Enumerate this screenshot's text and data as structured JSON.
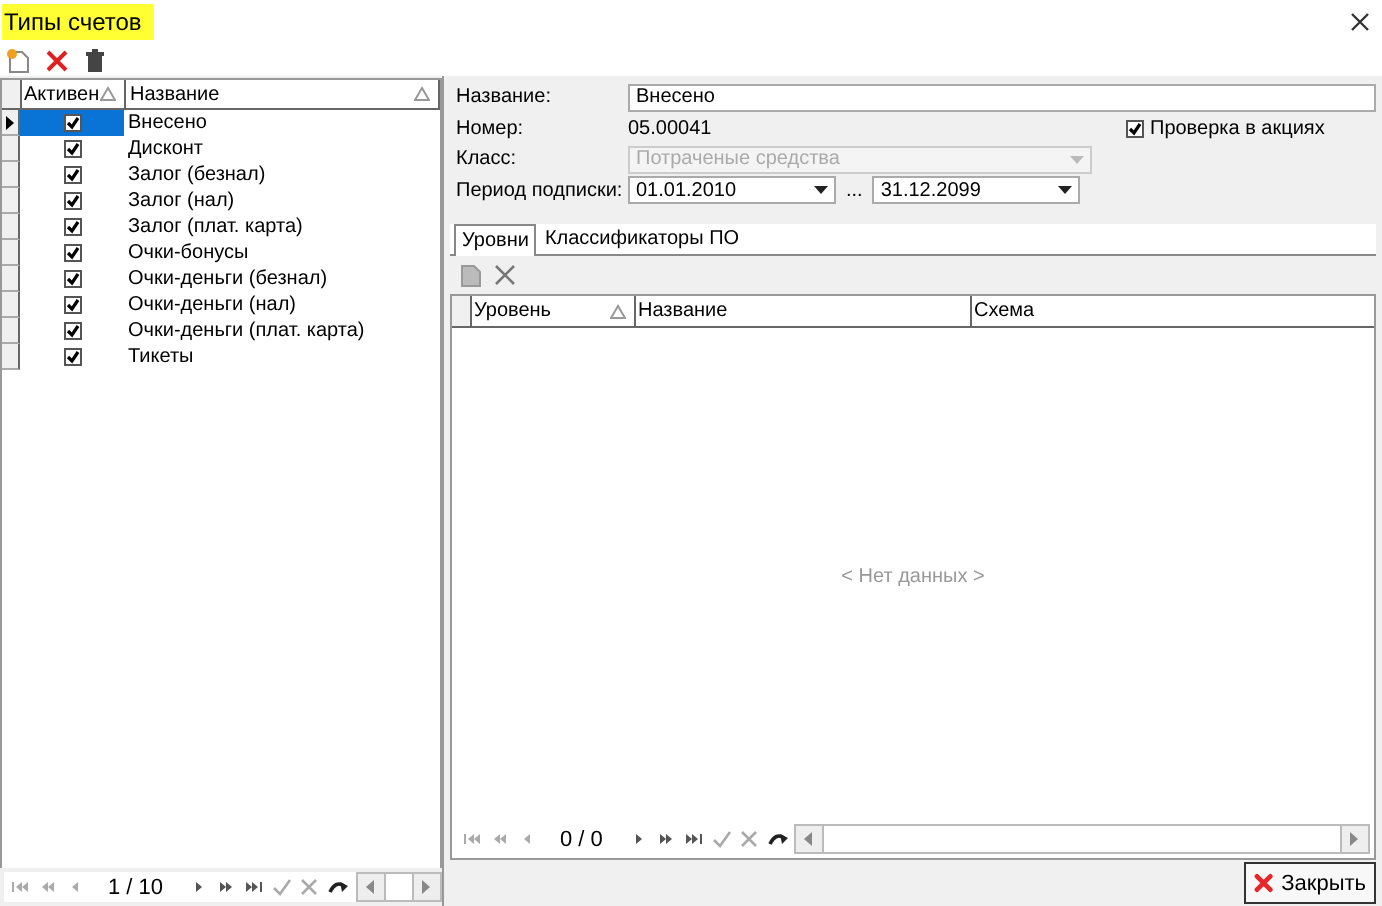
{
  "window": {
    "title": "Типы счетов"
  },
  "left_grid": {
    "columns": [
      {
        "label": "Активен",
        "sortable": true
      },
      {
        "label": "Название",
        "sortable": true
      }
    ],
    "rows": [
      {
        "name": "Внесено",
        "active": true,
        "selected": true
      },
      {
        "name": "Дисконт",
        "active": true,
        "selected": false
      },
      {
        "name": "Залог (безнал)",
        "active": true,
        "selected": false
      },
      {
        "name": "Залог (нал)",
        "active": true,
        "selected": false
      },
      {
        "name": "Залог (плат. карта)",
        "active": true,
        "selected": false
      },
      {
        "name": "Очки-бонусы",
        "active": true,
        "selected": false
      },
      {
        "name": "Очки-деньги (безнал)",
        "active": true,
        "selected": false
      },
      {
        "name": "Очки-деньги (нал)",
        "active": true,
        "selected": false
      },
      {
        "name": "Очки-деньги (плат. карта)",
        "active": true,
        "selected": false
      },
      {
        "name": "Тикеты",
        "active": true,
        "selected": false
      }
    ],
    "pager": "1 / 10"
  },
  "form": {
    "name_label": "Название:",
    "name_value": "Внесено",
    "number_label": "Номер:",
    "number_value": "05.00041",
    "promo_check": {
      "label": "Проверка в акциях",
      "checked": true
    },
    "class_label": "Класс:",
    "class_value": "Потраченые средства",
    "class_disabled": true,
    "period_label": "Период подписки:",
    "period_from": "01.01.2010",
    "period_separator": "...",
    "period_to": "31.12.2099"
  },
  "tabs": [
    {
      "label": "Уровни",
      "selected": true
    },
    {
      "label": "Классификаторы ПО",
      "selected": false
    }
  ],
  "levels_grid": {
    "columns": [
      {
        "label": "Уровень",
        "sortable": true
      },
      {
        "label": "Название",
        "sortable": false
      },
      {
        "label": "Схема",
        "sortable": false
      }
    ],
    "empty_text": "< Нет данных >",
    "pager": "0 / 0"
  },
  "close_button": "Закрыть"
}
